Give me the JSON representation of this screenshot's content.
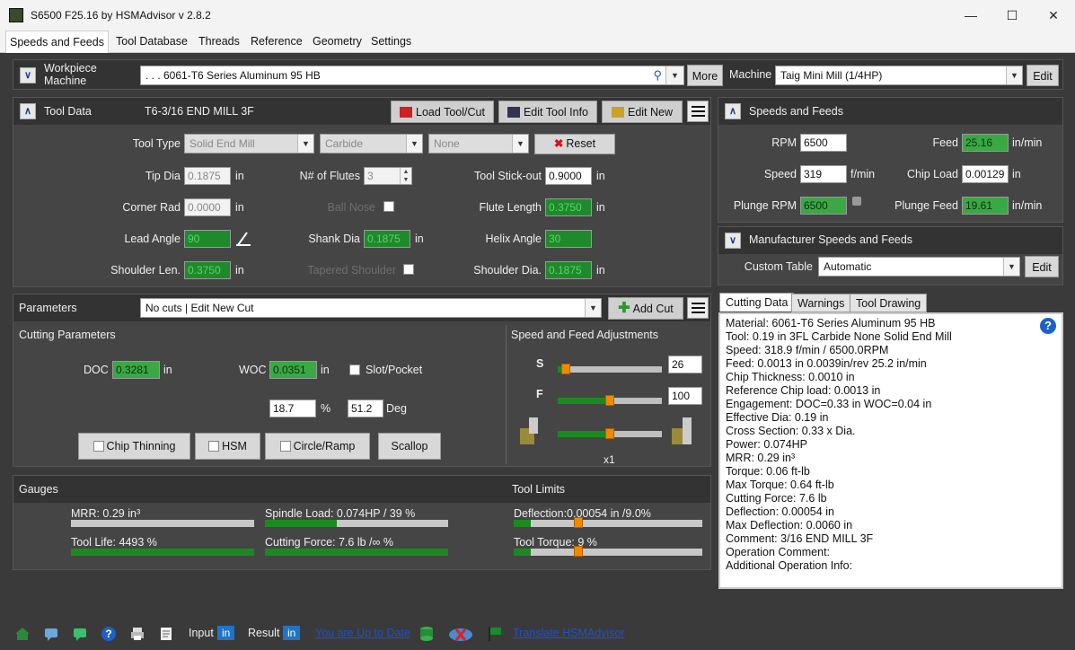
{
  "window": {
    "title": "S6500 F25.16 by HSMAdvisor v 2.8.2"
  },
  "tabs": [
    "Speeds and Feeds",
    "Tool Database",
    "Threads",
    "Reference",
    "Geometry",
    "Settings"
  ],
  "workpiece": {
    "label1": "Workpiece",
    "label2": "Machine",
    "material": ". . . 6061-T6 Series Aluminum 95 HB",
    "more": "More",
    "machine_label": "Machine",
    "machine": "Taig Mini Mill (1/4HP)",
    "edit": "Edit"
  },
  "tool": {
    "header": "Tool Data",
    "name": "T6-3/16 END MILL 3F",
    "load": "Load Tool/Cut",
    "edit_info": "Edit Tool Info",
    "edit_new": "Edit New",
    "type_label": "Tool Type",
    "type": "Solid End Mill",
    "material": "Carbide",
    "coating": "None",
    "reset": "Reset",
    "tip_dia_label": "Tip Dia",
    "tip_dia": "0.1875",
    "in": "in",
    "flutes_label": "N# of Flutes",
    "flutes": "3",
    "stickout_label": "Tool Stick-out",
    "stickout": "0.9000",
    "corner_label": "Corner Rad",
    "corner": "0.0000",
    "ball_label": "Ball Nose",
    "flute_len_label": "Flute Length",
    "flute_len": "0.3750",
    "lead_label": "Lead Angle",
    "lead": "90",
    "shank_label": "Shank Dia",
    "shank": "0.1875",
    "helix_label": "Helix Angle",
    "helix": "30",
    "shoulder_len_label": "Shoulder Len.",
    "shoulder_len": "0.3750",
    "tapered_label": "Tapered Shoulder",
    "shoulder_dia_label": "Shoulder Dia.",
    "shoulder_dia": "0.1875"
  },
  "params": {
    "header": "Parameters",
    "cut": "No cuts | Edit New Cut",
    "add_cut": "Add Cut",
    "cutting_label": "Cutting Parameters",
    "doc_label": "DOC",
    "doc": "0.3281",
    "woc_label": "WOC",
    "woc": "0.0351",
    "slot": "Slot/Pocket",
    "pct": "18.7",
    "pct_unit": "%",
    "deg": "51.2",
    "deg_unit": "Deg",
    "chip_thinning": "Chip Thinning",
    "hsm": "HSM",
    "circle": "Circle/Ramp",
    "scallop": "Scallop",
    "adj_label": "Speed and Feed Adjustments",
    "s_label": "S",
    "s_val": "26",
    "f_label": "F",
    "f_val": "100",
    "mult": "x1",
    "s_pct": 0.08,
    "f_pct": 0.5,
    "t_pct": 0.5
  },
  "gauges": {
    "header": "Gauges",
    "limits": "Tool Limits",
    "mrr": "MRR: 0.29 in³",
    "spindle": "Spindle Load: 0.074HP / 39 %",
    "deflection": "Deflection:0.00054 in /9.0%",
    "life": "Tool Life: 4493 %",
    "force": "Cutting Force: 7.6 lb /∞ %",
    "torque": "Tool Torque: 9 %",
    "mrr_pct": 0.0,
    "spindle_pct": 0.39,
    "deflection_pct": 0.09,
    "life_pct": 1.0,
    "force_pct": 1.0,
    "torque_pct": 0.09
  },
  "speeds": {
    "header": "Speeds and Feeds",
    "rpm_label": "RPM",
    "rpm": "6500",
    "feed_label": "Feed",
    "feed": "25.16",
    "feed_unit": "in/min",
    "speed_label": "Speed",
    "speed": "319",
    "speed_unit": "f/min",
    "chip_label": "Chip Load",
    "chip": "0.00129",
    "chip_unit": "in",
    "prpm_label": "Plunge RPM",
    "prpm": "6500",
    "pfeed_label": "Plunge Feed",
    "pfeed": "19.61",
    "pfeed_unit": "in/min"
  },
  "mfr": {
    "header": "Manufacturer Speeds and Feeds",
    "table_label": "Custom Table",
    "table": "Automatic",
    "edit": "Edit"
  },
  "info_tabs": [
    "Cutting Data",
    "Warnings",
    "Tool Drawing"
  ],
  "info_lines": [
    "Material: 6061-T6 Series Aluminum 95 HB",
    "Tool: 0.19 in 3FL Carbide None Solid End Mill",
    "Speed: 318.9 f/min / 6500.0RPM",
    "Feed: 0.0013 in 0.0039in/rev 25.2 in/min",
    "Chip Thickness: 0.0010 in",
    "Reference Chip load: 0.0013 in",
    "Engagement: DOC=0.33 in WOC=0.04 in",
    "Effective Dia: 0.19 in",
    "Cross Section: 0.33 x Dia.",
    "Power: 0.074HP",
    "MRR: 0.29 in³",
    "Torque: 0.06 ft-lb",
    "Max Torque: 0.64 ft-lb",
    "Cutting Force: 7.6 lb",
    "Deflection: 0.00054 in",
    "Max Deflection: 0.0060 in",
    "Comment: 3/16 END MILL 3F",
    "Operation Comment:",
    "Additional Operation Info:"
  ],
  "status": {
    "input": "Input",
    "input_unit": "in",
    "result": "Result",
    "result_unit": "in",
    "uptodate": "You are Up to Date",
    "translate": "Translate HSMAdvisor"
  }
}
